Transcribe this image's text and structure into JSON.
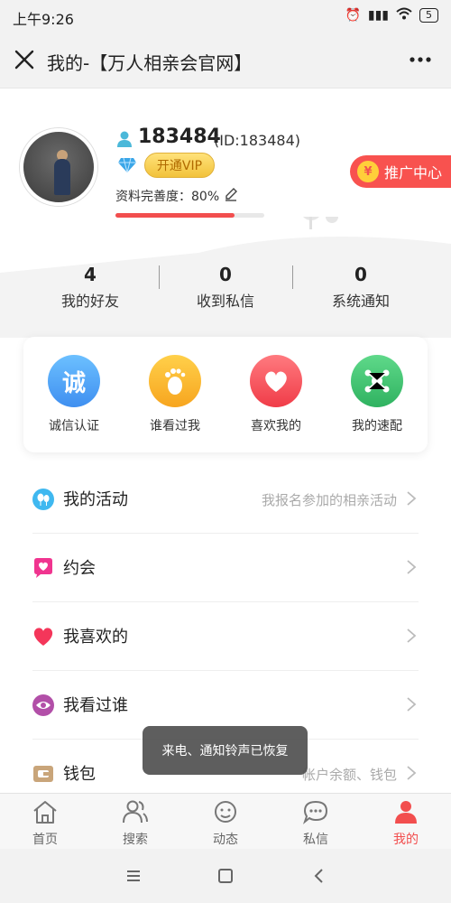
{
  "status_bar": {
    "time": "上午9:26",
    "battery": "5"
  },
  "title_bar": {
    "title": "我的-【万人相亲会官网】"
  },
  "profile": {
    "username": "183484",
    "user_id": "(ID:183484)",
    "vip_label": "开通VIP",
    "completeness_label": "资料完善度：80%",
    "completeness": 0.8,
    "promo_label": "推广中心",
    "promo_symbol": "¥"
  },
  "stats": [
    {
      "count": "4",
      "label": "我的好友"
    },
    {
      "count": "0",
      "label": "收到私信"
    },
    {
      "count": "0",
      "label": "系统通知"
    }
  ],
  "quick_actions": [
    {
      "label": "诚信认证",
      "glyph": "诚",
      "color": "#4aa6f5",
      "icon": "integrity-icon"
    },
    {
      "label": "谁看过我",
      "glyph": "",
      "color": "#fbb532",
      "icon": "footprint-icon"
    },
    {
      "label": "喜欢我的",
      "glyph": "",
      "color": "#f6565e",
      "icon": "heart-icon"
    },
    {
      "label": "我的速配",
      "glyph": "",
      "color": "#3fc874",
      "icon": "match-icon"
    }
  ],
  "menu": [
    {
      "label": "我的活动",
      "hint": "我报名参加的相亲活动",
      "icon": "activity-icon",
      "color": "#3fb8f0"
    },
    {
      "label": "约会",
      "hint": "",
      "icon": "date-icon",
      "color": "#f0348f"
    },
    {
      "label": "我喜欢的",
      "hint": "",
      "icon": "heart-icon",
      "color": "#f4365a"
    },
    {
      "label": "我看过谁",
      "hint": "",
      "icon": "eye-icon",
      "color": "#b24fa8"
    },
    {
      "label": "钱包",
      "hint": "帐户余额、钱包",
      "icon": "wallet-icon",
      "color": "#c9a57a"
    }
  ],
  "toast": {
    "text": "来电、通知铃声已恢复"
  },
  "tabs": [
    {
      "label": "首页",
      "icon": "home-icon",
      "active": false
    },
    {
      "label": "搜索",
      "icon": "search-people-icon",
      "active": false
    },
    {
      "label": "动态",
      "icon": "moments-icon",
      "active": false
    },
    {
      "label": "私信",
      "icon": "message-icon",
      "active": false
    },
    {
      "label": "我的",
      "icon": "profile-icon",
      "active": true
    }
  ],
  "colors": {
    "accent": "#f24e4e",
    "vip_gold": "#f2c23b"
  }
}
